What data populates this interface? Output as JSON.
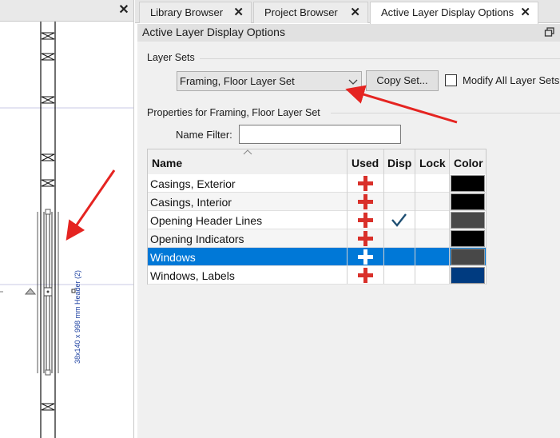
{
  "left_pane": {
    "dimension_label": "38x140 x 998 mm Header (2)"
  },
  "tabs": [
    {
      "label": "Library Browser",
      "active": false
    },
    {
      "label": "Project Browser",
      "active": false
    },
    {
      "label": "Active Layer Display Options",
      "active": true
    }
  ],
  "panel": {
    "title": "Active Layer Display Options"
  },
  "layer_sets": {
    "group_label": "Layer Sets",
    "selected": "Framing, Floor Layer Set",
    "copy_button": "Copy Set...",
    "modify_all_label": "Modify All Layer Sets",
    "modify_all_checked": false
  },
  "properties": {
    "group_label": "Properties for Framing, Floor Layer Set",
    "name_filter_label": "Name Filter:",
    "name_filter_value": ""
  },
  "table": {
    "headers": {
      "name": "Name",
      "used": "Used",
      "disp": "Disp",
      "lock": "Lock",
      "color": "Color"
    },
    "rows": [
      {
        "name": "Casings, Exterior",
        "used": true,
        "disp": false,
        "lock": false,
        "color": "#000000",
        "selected": false
      },
      {
        "name": "Casings, Interior",
        "used": true,
        "disp": false,
        "lock": false,
        "color": "#000000",
        "selected": false
      },
      {
        "name": "Opening Header Lines",
        "used": true,
        "disp": true,
        "lock": false,
        "color": "#484848",
        "selected": false
      },
      {
        "name": "Opening Indicators",
        "used": true,
        "disp": false,
        "lock": false,
        "color": "#000000",
        "selected": false
      },
      {
        "name": "Windows",
        "used": true,
        "disp": false,
        "lock": false,
        "color": "#484848",
        "selected": true
      },
      {
        "name": "Windows, Labels",
        "used": true,
        "disp": false,
        "lock": false,
        "color": "#003b80",
        "selected": false
      }
    ]
  },
  "colors": {
    "accent_selection": "#0078d7",
    "used_cross": "#d9302a",
    "check": "#1f4f73",
    "annotation_arrow": "#e52421"
  }
}
